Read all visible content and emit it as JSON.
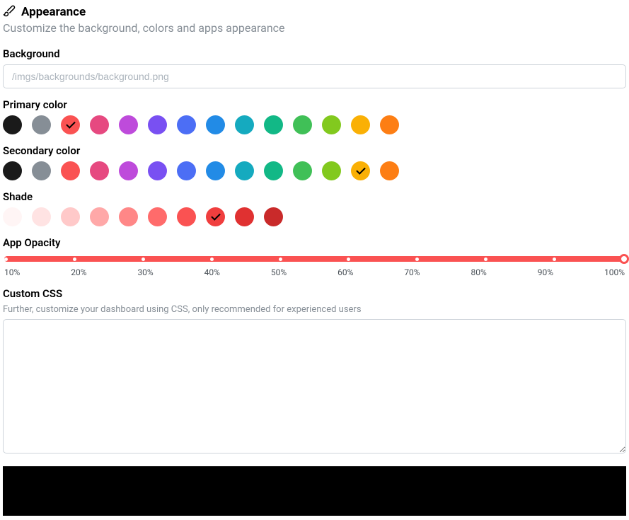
{
  "header": {
    "title": "Appearance",
    "subtitle": "Customize the background, colors and apps appearance"
  },
  "background": {
    "label": "Background",
    "placeholder": "/imgs/backgrounds/background.png",
    "value": ""
  },
  "primary": {
    "label": "Primary color",
    "selected_index": 2,
    "colors": [
      "#1a1a1a",
      "#868e96",
      "#fa5252",
      "#e64980",
      "#be4bdb",
      "#7950f2",
      "#4c6ef5",
      "#228be6",
      "#15aabf",
      "#12b886",
      "#40c057",
      "#82c91e",
      "#fab005",
      "#fd7e14"
    ]
  },
  "secondary": {
    "label": "Secondary color",
    "selected_index": 12,
    "colors": [
      "#1a1a1a",
      "#868e96",
      "#fa5252",
      "#e64980",
      "#be4bdb",
      "#7950f2",
      "#4c6ef5",
      "#228be6",
      "#15aabf",
      "#12b886",
      "#40c057",
      "#82c91e",
      "#fab005",
      "#fd7e14"
    ]
  },
  "shade": {
    "label": "Shade",
    "selected_index": 7,
    "colors": [
      "#fff5f5",
      "#ffe3e3",
      "#ffc9c9",
      "#ffa8a8",
      "#ff8787",
      "#ff6b6b",
      "#fa5252",
      "#f03e3e",
      "#e03131",
      "#c92a2a"
    ]
  },
  "opacity": {
    "label": "App Opacity",
    "value_index": 9,
    "labels": [
      "10%",
      "20%",
      "30%",
      "40%",
      "50%",
      "60%",
      "70%",
      "80%",
      "90%",
      "100%"
    ]
  },
  "customCss": {
    "label": "Custom CSS",
    "hint": "Further, customize your dashboard using CSS, only recommended for experienced users",
    "value": ""
  }
}
